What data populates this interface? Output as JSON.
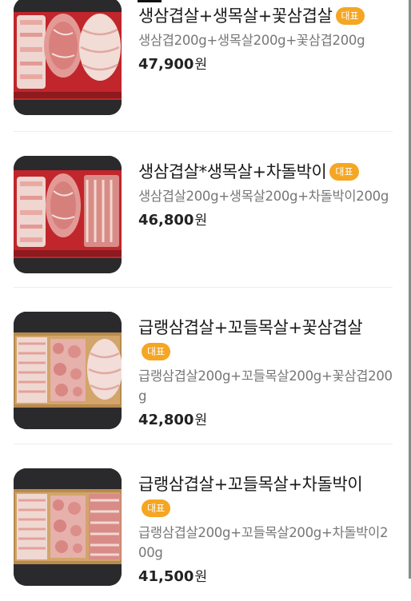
{
  "menu": {
    "items": [
      {
        "name": "생삼겹살+생목살+꽃삼겹살",
        "badge": "대표",
        "description": "생삼겹200g+생목살200g+꽃삼겹200g",
        "price": "47,900",
        "currency": "원",
        "image_icon": "pork-on-red-tray-image"
      },
      {
        "name": "생삼겹살*생목살+차돌박이",
        "badge": "대표",
        "description": "생삼겹살200g+생목살200g+차돌박이200g",
        "price": "46,800",
        "currency": "원",
        "image_icon": "pork-on-red-tray-image"
      },
      {
        "name": "급랭삼겹살+꼬들목살+꽃삼겹살",
        "badge": "대표",
        "description": "급랭삼겹살200g+꼬들목살200g+꽃삼겹200g",
        "price": "42,800",
        "currency": "원",
        "image_icon": "pork-on-wood-tray-image"
      },
      {
        "name": "급랭삼겹살+꼬들목살+차돌박이",
        "badge": "대표",
        "description": "급랭삼겹살200g+꼬들목살200g+차돌박이200g",
        "price": "41,500",
        "currency": "원",
        "image_icon": "pork-on-wood-tray-image"
      }
    ]
  },
  "colors": {
    "badge": "#f5a623",
    "description": "#777777",
    "title": "#1a1a1a"
  }
}
